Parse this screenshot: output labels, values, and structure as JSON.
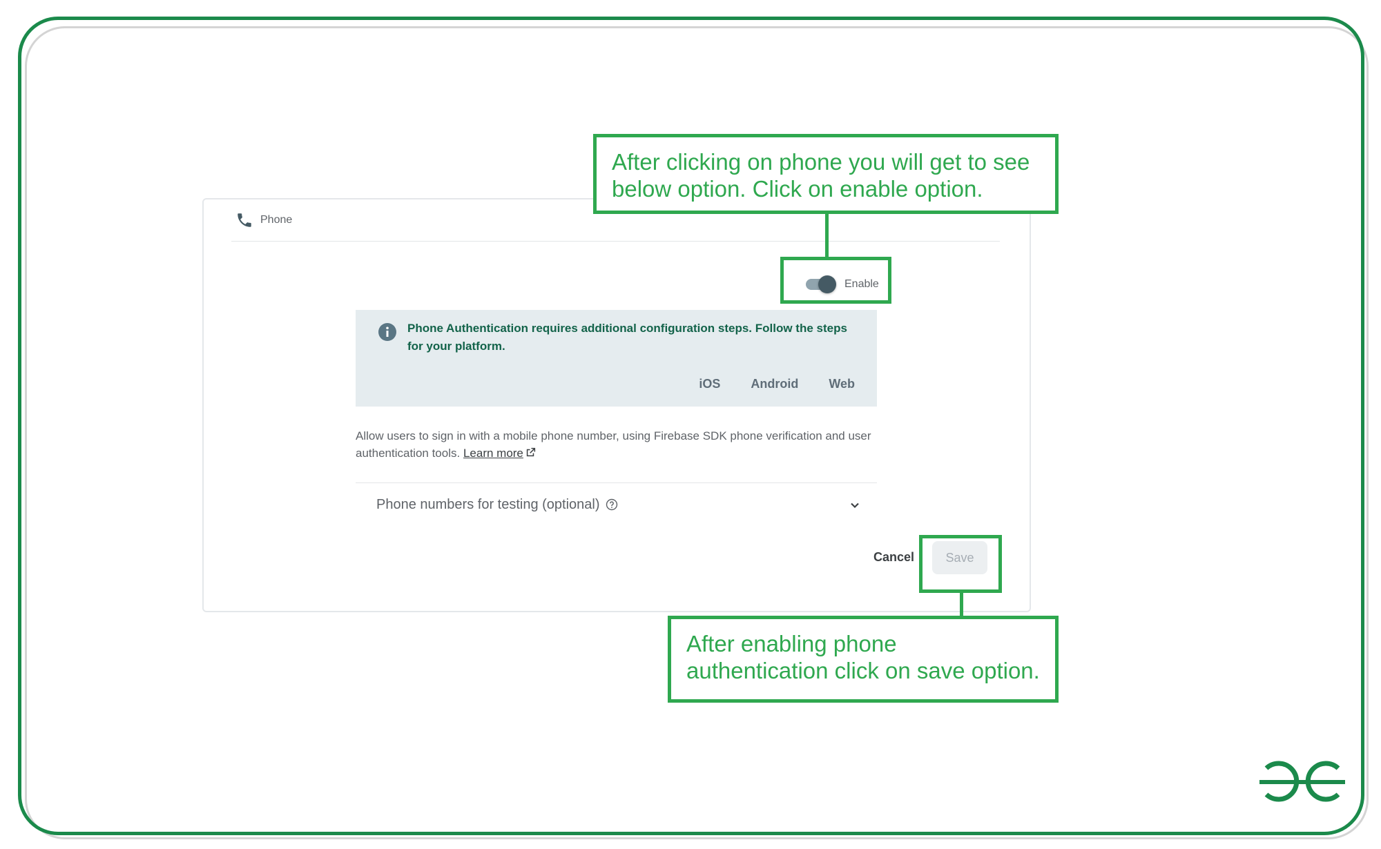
{
  "panel": {
    "header_label": "Phone",
    "header_icon": "phone-icon",
    "toggle": {
      "label": "Enable",
      "enabled": true
    },
    "info": {
      "icon": "info-icon",
      "text": "Phone Authentication requires additional configuration steps. Follow the steps for your platform.",
      "platforms": [
        "iOS",
        "Android",
        "Web"
      ]
    },
    "description": "Allow users to sign in with a mobile phone number, using Firebase SDK phone verification and user authentication tools.",
    "learn_more": "Learn more",
    "testing_label": "Phone numbers for testing (optional)",
    "cancel_label": "Cancel",
    "save_label": "Save"
  },
  "annotations": {
    "top": "After clicking on phone you will get to see below option. Click on enable option.",
    "bottom": "After enabling phone authentication click on save option."
  },
  "colors": {
    "frame": "#1b8a4b",
    "callout": "#2fa84f",
    "info_bg": "#e5ecef",
    "info_text": "#13634a"
  }
}
